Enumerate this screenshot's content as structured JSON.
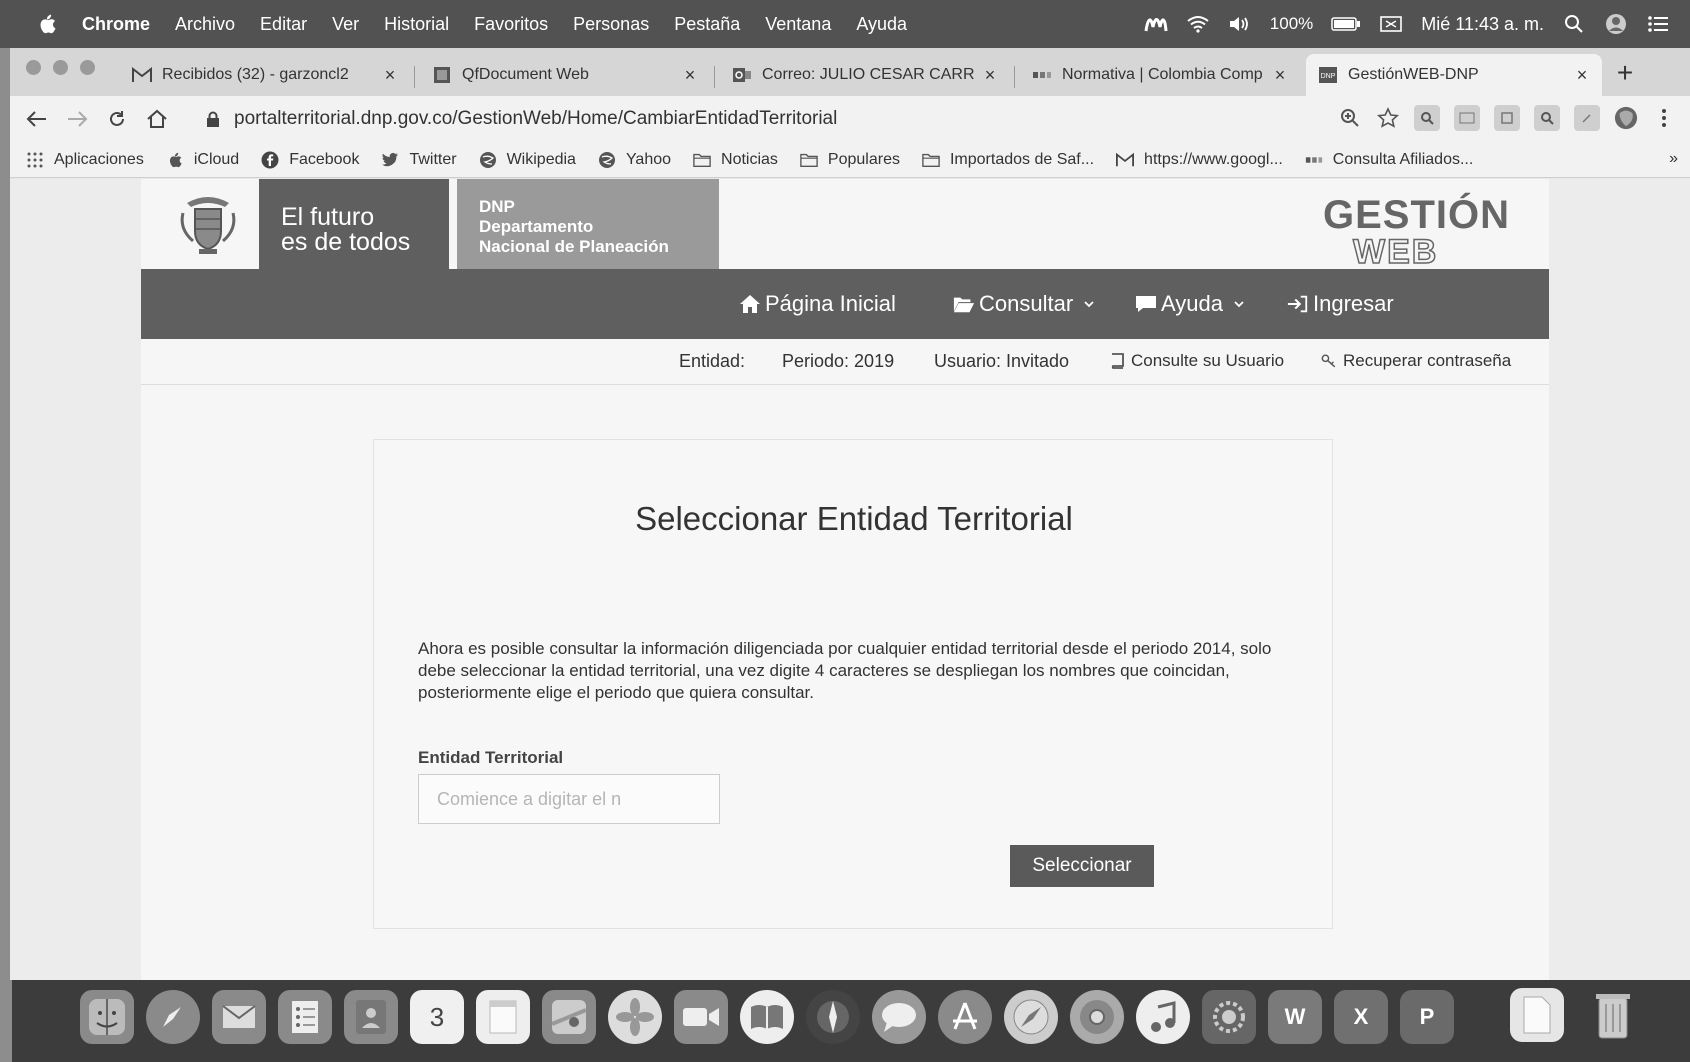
{
  "menubar": {
    "app": "Chrome",
    "items": [
      "Archivo",
      "Editar",
      "Ver",
      "Historial",
      "Favoritos",
      "Personas",
      "Pestaña",
      "Ventana",
      "Ayuda"
    ],
    "battery": "100%",
    "clock": "Mié 11:43 a. m."
  },
  "tabs": [
    {
      "title": "Recibidos (32) - garzoncl2",
      "icon": "gmail-icon"
    },
    {
      "title": "QfDocument Web",
      "icon": "document-icon"
    },
    {
      "title": "Correo: JULIO CESAR CARR",
      "icon": "outlook-icon"
    },
    {
      "title": "Normativa | Colombia Comp",
      "icon": "colombia-compra-icon"
    },
    {
      "title": "GestiónWEB-DNP",
      "icon": "dnp-icon"
    }
  ],
  "address": {
    "url": "portalterritorial.dnp.gov.co/GestionWeb/Home/CambiarEntidadTerritorial"
  },
  "bookmarks": [
    {
      "label": "Aplicaciones",
      "icon": "apps-grid-icon"
    },
    {
      "label": "iCloud",
      "icon": "apple-icon"
    },
    {
      "label": "Facebook",
      "icon": "facebook-icon"
    },
    {
      "label": "Twitter",
      "icon": "twitter-icon"
    },
    {
      "label": "Wikipedia",
      "icon": "globe-icon"
    },
    {
      "label": "Yahoo",
      "icon": "globe-icon"
    },
    {
      "label": "Noticias",
      "icon": "folder-icon"
    },
    {
      "label": "Populares",
      "icon": "folder-icon"
    },
    {
      "label": "Importados de Saf...",
      "icon": "folder-icon"
    },
    {
      "label": "https://www.googl...",
      "icon": "gmail-icon"
    },
    {
      "label": "Consulta Afiliados...",
      "icon": "bookmark-icon"
    }
  ],
  "bookmarks_more": "»",
  "header": {
    "slogan_line1": "El futuro",
    "slogan_line2": "es de todos",
    "dnp_line1": "DNP",
    "dnp_line2": "Departamento",
    "dnp_line3": "Nacional de Planeación",
    "logo_top": "GESTIÓN",
    "logo_bottom": "WEB"
  },
  "nav": {
    "home": "Página Inicial",
    "consultar": "Consultar",
    "ayuda": "Ayuda",
    "ingresar": "Ingresar"
  },
  "info": {
    "entidad": "Entidad:",
    "periodo": "Periodo: 2019",
    "usuario": "Usuario: Invitado",
    "consulte": "Consulte su Usuario",
    "recuperar": "Recuperar contraseña"
  },
  "card": {
    "title": "Seleccionar Entidad Territorial",
    "text": "Ahora es posible consultar la información diligenciada por cualquier entidad territorial desde el periodo 2014, solo debe seleccionar la entidad territorial, una vez digite 4 caracteres se despliegan los nombres que coincidan, posteriormente elige el periodo que quiera consultar.",
    "field_label": "Entidad Territorial",
    "field_placeholder": "Comience a digitar el n",
    "button": "Seleccionar"
  },
  "dock": {
    "calendar_day": "3",
    "word": "W",
    "excel": "X",
    "powerpoint": "P"
  }
}
